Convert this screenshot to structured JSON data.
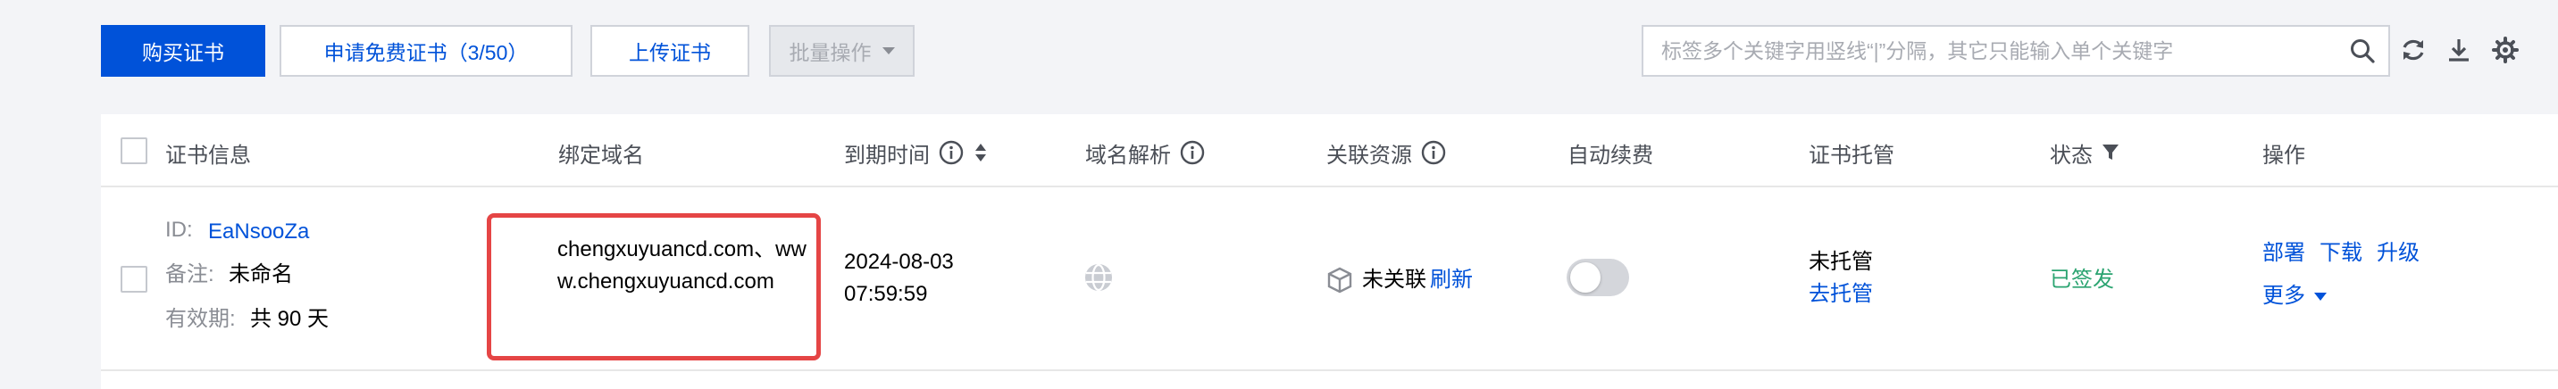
{
  "toolbar": {
    "buy_label": "购买证书",
    "free_label": "申请免费证书（3/50）",
    "upload_label": "上传证书",
    "batch_label": "批量操作"
  },
  "search": {
    "placeholder": "标签多个关键字用竖线“|”分隔，其它只能输入单个关键字"
  },
  "table": {
    "headers": {
      "cert_info": "证书信息",
      "bound_domain": "绑定域名",
      "expire_time": "到期时间",
      "dns": "域名解析",
      "resources": "关联资源",
      "auto_renew": "自动续费",
      "hosting": "证书托管",
      "status": "状态",
      "actions": "操作"
    },
    "row": {
      "id_label": "ID:",
      "id_value": "EaNsooZa",
      "remark_label": "备注:",
      "remark_value": "未命名",
      "validity_label": "有效期:",
      "validity_value": "共 90 天",
      "domain": "chengxuyuancd.com、www.chengxuyuancd.com",
      "expire_date": "2024-08-03",
      "expire_time": "07:59:59",
      "resource_status": "未关联",
      "refresh_label": "刷新",
      "auto_renew_on": false,
      "hosting_status": "未托管",
      "hosting_action": "去托管",
      "status": "已签发",
      "action_deploy": "部署",
      "action_download": "下载",
      "action_upgrade": "升级",
      "action_more": "更多"
    }
  },
  "colors": {
    "primary": "#0052d9",
    "success": "#2ba471",
    "highlight": "#e54545"
  }
}
